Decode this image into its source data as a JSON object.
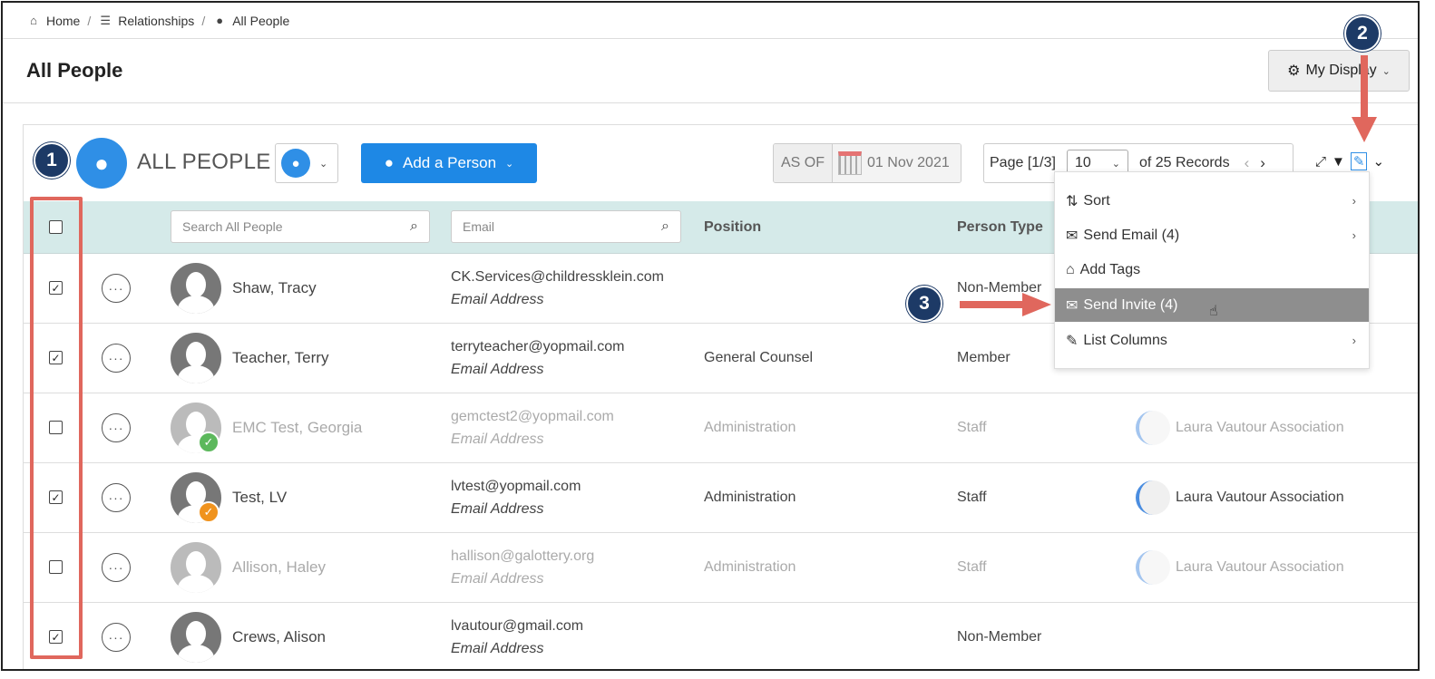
{
  "breadcrumb": {
    "home": "Home",
    "relationships": "Relationships",
    "all_people": "All People",
    "home_icon": "home-icon",
    "relationships_icon": "list-icon",
    "people_icon": "people-icon"
  },
  "page_title": "All People",
  "my_display": {
    "label": "My Display",
    "icon": "gear-icon"
  },
  "toolbar": {
    "title": "ALL PEOPLE",
    "add_person": "Add a Person",
    "as_of_label": "AS OF",
    "as_of_date": "01 Nov 2021",
    "page_label": "Page [1/3]",
    "page_size": "10",
    "records": "of 25 Records"
  },
  "header": {
    "search_placeholder": "Search All People",
    "email_placeholder": "Email",
    "position": "Position",
    "person_type": "Person Type"
  },
  "rows": [
    {
      "name": "Shaw, Tracy",
      "email": "CK.Services@childressklein.com",
      "email_label": "Email Address",
      "position": "",
      "type": "Non-Member",
      "association": "",
      "checked": true,
      "dim": false
    },
    {
      "name": "Teacher, Terry",
      "email": "terryteacher@yopmail.com",
      "email_label": "Email Address",
      "position": "General Counsel",
      "type": "Member",
      "association": "",
      "checked": true,
      "dim": false
    },
    {
      "name": "EMC Test, Georgia",
      "email": "gemctest2@yopmail.com",
      "email_label": "Email Address",
      "position": "Administration",
      "type": "Staff",
      "association": "Laura Vautour Association",
      "checked": false,
      "dim": true
    },
    {
      "name": "Test, LV",
      "email": "lvtest@yopmail.com",
      "email_label": "Email Address",
      "position": "Administration",
      "type": "Staff",
      "association": "Laura Vautour Association",
      "checked": true,
      "dim": false
    },
    {
      "name": "Allison, Haley",
      "email": "hallison@galottery.org",
      "email_label": "Email Address",
      "position": "Administration",
      "type": "Staff",
      "association": "Laura Vautour Association",
      "checked": false,
      "dim": true
    },
    {
      "name": "Crews, Alison",
      "email": "lvautour@gmail.com",
      "email_label": "Email Address",
      "position": "",
      "type": "Non-Member",
      "association": "",
      "checked": true,
      "dim": false
    }
  ],
  "menu": {
    "sort": "Sort",
    "send_email": "Send Email (4)",
    "add_tags": "Add Tags",
    "send_invite": "Send Invite (4)",
    "list_columns": "List Columns"
  },
  "markers": {
    "one": "1",
    "two": "2",
    "three": "3"
  },
  "colors": {
    "accent": "#1e88e5",
    "header_bg": "#d5eae9",
    "annotation": "#e0675d",
    "marker": "#1d3a66"
  }
}
